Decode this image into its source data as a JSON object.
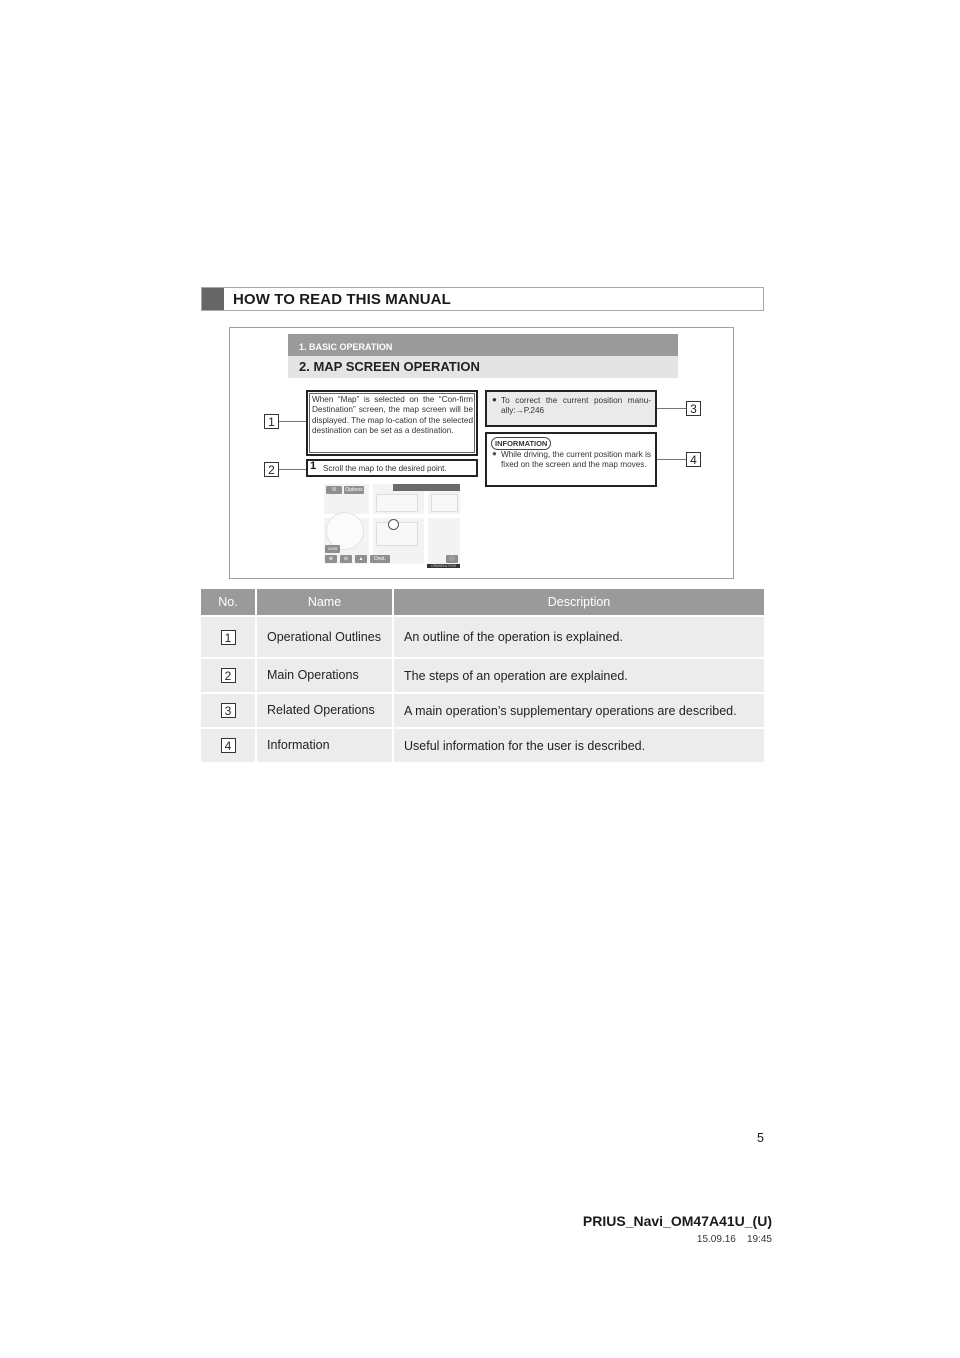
{
  "section_header": {
    "title": "HOW TO READ THIS MANUAL"
  },
  "sample_page": {
    "subsection": "1. BASIC OPERATION",
    "title": "2. MAP SCREEN OPERATION",
    "outline_text": "When “Map” is selected on the “Con-firm Destination” screen, the map screen will be displayed. The map lo-cation of the selected destination can be set as a destination.",
    "step_number": "1",
    "step_text": "Scroll the map to the desired point.",
    "related_text": "To correct the current position manu-ally:→P.246",
    "information_label": "INFORMATION",
    "information_text": "While driving, the current position mark is fixed on the screen and the map moves.",
    "callouts": [
      "1",
      "2",
      "3",
      "4"
    ],
    "map": {
      "north_label": "N",
      "options_label": "Options",
      "scale_label": "200ft",
      "dest_label": "Dest.",
      "image_id": "CRM0ENLTK05"
    }
  },
  "table": {
    "headers": [
      "No.",
      "Name",
      "Description"
    ],
    "rows": [
      {
        "no": "1",
        "name": "Operational Outlines",
        "description": "An outline of the operation is explained."
      },
      {
        "no": "2",
        "name": "Main Operations",
        "description": "The steps of an operation are explained."
      },
      {
        "no": "3",
        "name": "Related Operations",
        "description": "A main operation’s supplementary operations are described."
      },
      {
        "no": "4",
        "name": "Information",
        "description": "Useful information for the user is described."
      }
    ]
  },
  "footer": {
    "page_number": "5",
    "document_id": "PRIUS_Navi_OM47A41U_(U)",
    "date": "15.09.16",
    "time": "19:45"
  }
}
